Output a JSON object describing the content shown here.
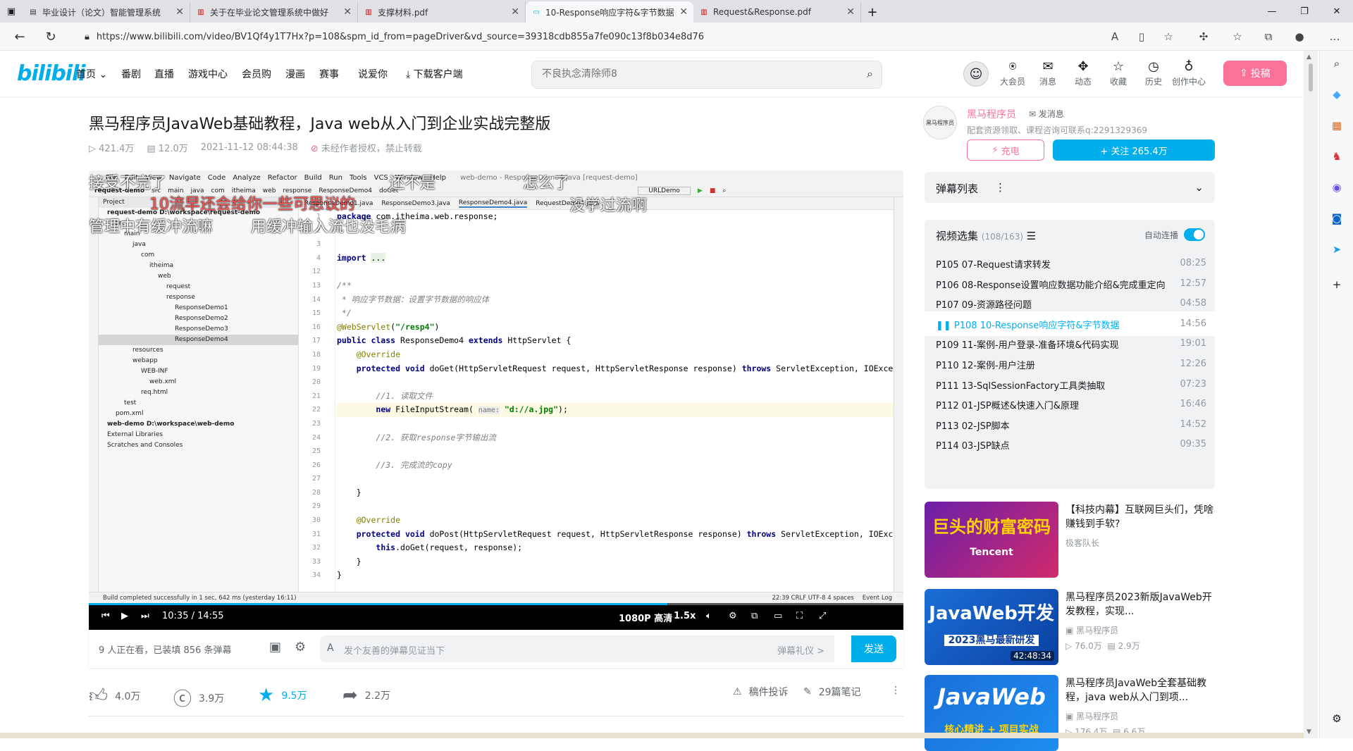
{
  "browser": {
    "tabs": [
      {
        "label": "毕业设计（论文）智能管理系统",
        "icon": "doc-icon"
      },
      {
        "label": "关于在毕业论文管理系统中做好",
        "icon": "pdf-icon"
      },
      {
        "label": "支撑材料.pdf",
        "icon": "pdf-icon"
      },
      {
        "label": "10-Response响应字符&字节数据",
        "icon": "tv-icon",
        "active": true
      },
      {
        "label": "Request&Response.pdf",
        "icon": "pdf-icon"
      }
    ],
    "url": "https://www.bilibili.com/video/BV1Qf4y1T7Hx?p=108&spm_id_from=pageDriver&vd_source=39318cdb855a7fe090c13f8b034e8d76"
  },
  "header": {
    "logo": "bilibili",
    "nav": [
      "首页",
      "番剧",
      "直播",
      "游戏中心",
      "会员购",
      "漫画",
      "赛事",
      "说爱你",
      "下载客户端"
    ],
    "search_placeholder": "不良执念清除师8",
    "icons": [
      {
        "label": "大会员",
        "icon": "vip-icon"
      },
      {
        "label": "消息",
        "icon": "message-icon"
      },
      {
        "label": "动态",
        "icon": "dynamic-icon"
      },
      {
        "label": "收藏",
        "icon": "star-icon"
      },
      {
        "label": "历史",
        "icon": "history-icon"
      },
      {
        "label": "创作中心",
        "icon": "bulb-icon"
      }
    ],
    "upload": "投稿"
  },
  "video": {
    "title": "黑马程序员JavaWeb基础教程，Java web从入门到企业实战完整版",
    "views": "421.4万",
    "danmaku": "12.0万",
    "date": "2021-11-12 08:44:38",
    "notice": "未经作者授权，禁止转载"
  },
  "ide": {
    "menu": [
      "File",
      "Edit",
      "View",
      "Navigate",
      "Code",
      "Analyze",
      "Refactor",
      "Build",
      "Run",
      "Tools",
      "VCS",
      "Window",
      "Help"
    ],
    "window_title": "web-demo - ResponseDemo4.java [request-demo]",
    "breadcrumb": [
      "request-demo",
      "src",
      "main",
      "java",
      "com",
      "itheima",
      "web",
      "response",
      "ResponseDemo4",
      "doGet"
    ],
    "run_config": "URLDemo",
    "tabs": [
      "ResponseDemo1.java",
      "ResponseDemo3.java",
      "ResponseDemo4.java",
      "RequestDemo5.java"
    ],
    "tree": [
      "Project",
      "request-demo  D:\\workspace\\request-demo",
      "src",
      "main",
      "java",
      "com",
      "itheima",
      "web",
      "request",
      "response",
      "ResponseDemo1",
      "ResponseDemo2",
      "ResponseDemo3",
      "ResponseDemo4",
      "resources",
      "webapp",
      "WEB-INF",
      "web.xml",
      "req.html",
      "test",
      "pom.xml",
      "web-demo  D:\\workspace\\web-demo",
      "External Libraries",
      "Scratches and Consoles"
    ],
    "line_numbers": [
      "1",
      "2",
      "3",
      "4",
      "12",
      "13",
      "14",
      "15",
      "16",
      "17",
      "18",
      "19",
      "20",
      "21",
      "22",
      "23",
      "24",
      "25",
      "26",
      "27",
      "28",
      "29",
      "30",
      "31",
      "32",
      "33",
      "34"
    ],
    "status_left": "Build completed successfully in 1 sec, 642 ms (yesterday 16:11)",
    "status_right": "22:39   CRLF   UTF-8   4 spaces",
    "event_log": "Event Log"
  },
  "danmaku_overlay": [
    "接受不完了",
    "10流早还会给你一些可思议的",
    "还不是",
    "怎么了",
    "没学过流啊",
    "管理中有缓冲流嘛",
    "用缓冲输入流也没毛病"
  ],
  "controls": {
    "time": "10:35 / 14:55",
    "quality": "1080P 高清",
    "speed": "1.5x",
    "progress_fraction": 0.71
  },
  "watching": {
    "count": "9 人正在看，已装填 856 条弹幕",
    "placeholder": "发个友善的弹幕见证当下",
    "etiquette": "弹幕礼仪 >",
    "send": "发送"
  },
  "actions": {
    "like": "4.0万",
    "coin": "3.9万",
    "fav": "9.5万",
    "share": "2.2万",
    "report": "稿件投诉",
    "notes": "29篇笔记"
  },
  "uploader": {
    "avatar_text": "黑马程序员",
    "name": "黑马程序员",
    "message": "发消息",
    "desc": "配套资源领取、课程咨询可联系q:2291329369",
    "charge": "充电",
    "follow": "+ 关注 265.4万"
  },
  "danmaku_list": {
    "label": "弹幕列表"
  },
  "episodes": {
    "header": "视频选集",
    "count": "(108/163)",
    "autoplay": "自动连播",
    "items": [
      {
        "label": "P105  07-Request请求转发",
        "dur": "08:25"
      },
      {
        "label": "P106  08-Response设置响应数据功能介绍&完成重定向",
        "dur": "12:57"
      },
      {
        "label": "P107  09-资源路径问题",
        "dur": "04:58"
      },
      {
        "label": "P108  10-Response响应字符&字节数据",
        "dur": "14:56",
        "current": true
      },
      {
        "label": "P109  11-案例-用户登录-准备环境&代码实现",
        "dur": "19:01"
      },
      {
        "label": "P110  12-案例-用户注册",
        "dur": "12:26"
      },
      {
        "label": "P111  13-SqlSessionFactory工具类抽取",
        "dur": "07:23"
      },
      {
        "label": "P112  01-JSP概述&快速入门&原理",
        "dur": "16:46"
      },
      {
        "label": "P113  02-JSP脚本",
        "dur": "14:52"
      },
      {
        "label": "P114  03-JSP缺点",
        "dur": "09:35"
      }
    ]
  },
  "recommend": [
    {
      "thumb": "巨头的财富密码",
      "thumb2": "Tencent",
      "title": "【科技内幕】互联网巨头们，凭啥赚钱到手软?",
      "up": "极客队长",
      "views": "",
      "danmaku": "",
      "dur": ""
    },
    {
      "thumb": "JavaWeb开发",
      "thumb2": "2023黑马最新研发",
      "title": "黑马程序员2023新版JavaWeb开发教程，实现...",
      "up": "黑马程序员",
      "views": "76.0万",
      "danmaku": "2.9万",
      "dur": "42:48:34"
    },
    {
      "thumb": "JavaWeb",
      "thumb2": "核心精讲 + 项目实战",
      "title": "黑马程序员JavaWeb全套基础教程，java web从入门到项...",
      "up": "黑马程序员",
      "views": "176.4万",
      "danmaku": "6.6万",
      "dur": ""
    }
  ],
  "colors": {
    "accent": "#00aeec",
    "pink": "#fb7299"
  }
}
